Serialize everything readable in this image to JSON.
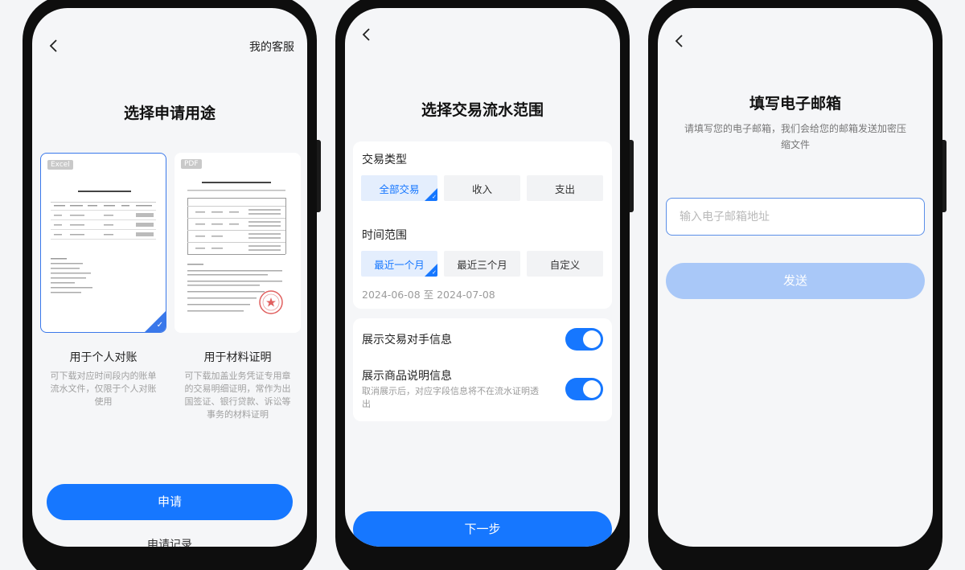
{
  "screen1": {
    "top_right": "我的客服",
    "title": "选择申请用途",
    "cards": [
      {
        "tag": "Excel",
        "name": "用于个人对账",
        "desc": "可下载对应时间段内的账单流水文件，仅限于个人对账使用",
        "selected": true
      },
      {
        "tag": "PDF",
        "name": "用于材料证明",
        "desc": "可下载加盖业务凭证专用章的交易明细证明，常作为出国签证、银行贷款、诉讼等事务的材料证明",
        "selected": false
      }
    ],
    "apply_button": "申请",
    "record_link": "申请记录"
  },
  "screen2": {
    "title": "选择交易流水范围",
    "type_label": "交易类型",
    "type_options": [
      "全部交易",
      "收入",
      "支出"
    ],
    "time_label": "时间范围",
    "time_options": [
      "最近一个月",
      "最近三个月",
      "自定义"
    ],
    "date_range": "2024-06-08 至 2024-07-08",
    "toggle1_label": "展示交易对手信息",
    "toggle2_label": "展示商品说明信息",
    "toggle2_sub": "取消展示后，对应字段信息将不在流水证明透出",
    "next_button": "下一步"
  },
  "screen3": {
    "title": "填写电子邮箱",
    "subtitle": "请填写您的电子邮箱，我们会给您的邮箱发送加密压缩文件",
    "email_placeholder": "输入电子邮箱地址",
    "send_button": "发送"
  },
  "colors": {
    "accent": "#1677ff",
    "disabled": "#a9c8f8",
    "background": "#f5f6f8"
  }
}
